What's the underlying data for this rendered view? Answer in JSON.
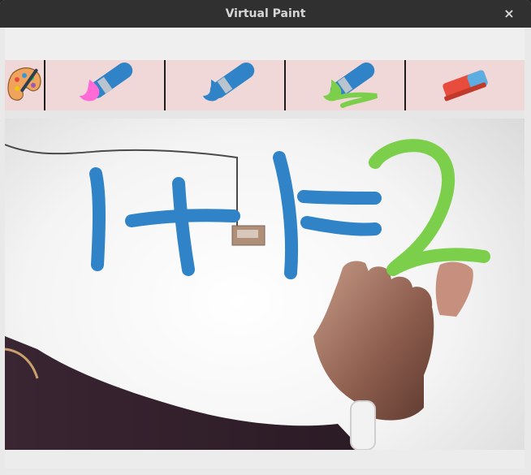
{
  "window": {
    "title": "Virtual Paint",
    "close_glyph": "×"
  },
  "toolbar": {
    "tools": [
      {
        "name": "palette",
        "icon": "palette-icon"
      },
      {
        "name": "pink-brush",
        "icon": "pink-brush-icon",
        "color": "#ff6bd6"
      },
      {
        "name": "blue-brush",
        "icon": "blue-brush-icon",
        "color": "#2f83c6"
      },
      {
        "name": "green-brush",
        "icon": "green-brush-icon",
        "color": "#7ccf4a"
      },
      {
        "name": "eraser",
        "icon": "eraser-icon"
      }
    ]
  },
  "drawing": {
    "strokes": [
      {
        "name": "one",
        "color": "#2f83c6"
      },
      {
        "name": "plus",
        "color": "#2f83c6"
      },
      {
        "name": "one-second",
        "color": "#2f83c6"
      },
      {
        "name": "equals",
        "color": "#2f83c6"
      },
      {
        "name": "two",
        "color": "#7ccf4a"
      }
    ]
  }
}
